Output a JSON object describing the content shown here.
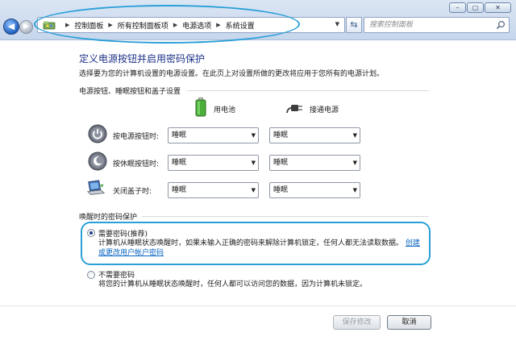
{
  "window": {
    "minimize_glyph": "–",
    "maximize_glyph": "▢",
    "close_glyph": "✕"
  },
  "address_bar": {
    "breadcrumbs": [
      "控制面板",
      "所有控制面板项",
      "电源选项",
      "系统设置"
    ],
    "search_placeholder": "搜索控制面板"
  },
  "page": {
    "title": "定义电源按钮并启用密码保护",
    "subtitle": "选择要为您的计算机设置的电源设置。在此页上对设置所做的更改将应用于您所有的电源计划。"
  },
  "buttons_section": {
    "heading": "电源按钮、睡眠按钮和盖子设置",
    "col_battery": "用电池",
    "col_plugged": "接通电源",
    "rows": [
      {
        "label": "按电源按钮时:",
        "battery": "睡眠",
        "plugged": "睡眠"
      },
      {
        "label": "按休眠按钮时:",
        "battery": "睡眠",
        "plugged": "睡眠"
      },
      {
        "label": "关闭盖子时:",
        "battery": "睡眠",
        "plugged": "睡眠"
      }
    ]
  },
  "password_section": {
    "heading": "唤醒时的密码保护",
    "require": {
      "title": "需要密码(推荐)",
      "desc_line1": "计算机从睡眠状态唤醒时，如果未输入正确的密码来解除计算机锁定，任何人都无法读取数据。",
      "link_part1": "创",
      "link_part2": "建或更改用户帐户密码",
      "selected": true
    },
    "not_require": {
      "title": "不需要密码",
      "desc": "将您的计算机从睡眠状态唤醒时，任何人都可以访问您的数据，因为计算机未锁定。",
      "selected": false
    }
  },
  "footer": {
    "save_label": "保存修改",
    "cancel_label": "取消"
  },
  "colors": {
    "title_blue": "#1e3287",
    "link_blue": "#0a66c2",
    "highlight_cyan": "#2a9fd8"
  }
}
